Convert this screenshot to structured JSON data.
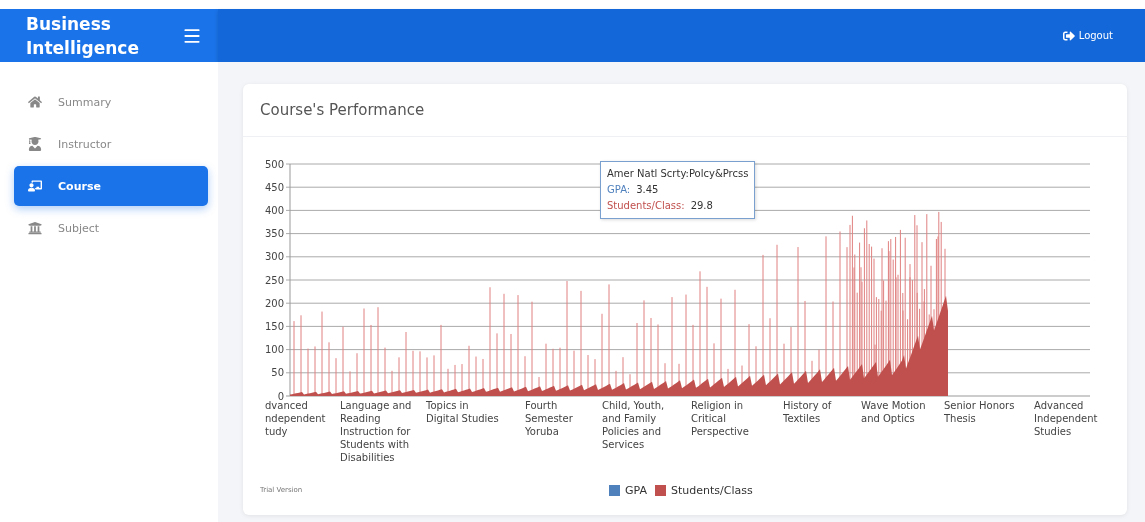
{
  "brand": {
    "title": "Business Intelligence"
  },
  "header": {
    "logout": "Logout"
  },
  "sidebar": {
    "items": [
      {
        "label": "Summary",
        "selected": false
      },
      {
        "label": "Instructor",
        "selected": false
      },
      {
        "label": "Course",
        "selected": true
      },
      {
        "label": "Subject",
        "selected": false
      }
    ]
  },
  "card": {
    "title": "Course's Performance",
    "chart": {
      "y_tick_labels": [
        "500",
        "450",
        "400",
        "350",
        "300",
        "250",
        "200",
        "150",
        "100",
        "50",
        "0"
      ],
      "x_labels": [
        "dvanced\nndependent\ntudy",
        "Language and\nReading\nInstruction for\nStudents with\nDisabilities",
        "Topics in\nDigital Studies",
        "Fourth\nSemester\nYoruba",
        "Child, Youth,\nand Family\nPolicies and\nServices",
        "Religion in\nCritical\nPerspective",
        "History of\nTextiles",
        "Wave Motion\nand Optics",
        "Senior Honors\nThesis",
        "Advanced\nIndependent\nStudies"
      ],
      "tooltip": {
        "title": "Amer Natl Scrty:Polcy&Prcss",
        "rows": [
          {
            "label": "GPA:",
            "value": "3.45",
            "color": "#4f81bd"
          },
          {
            "label": "Students/Class:",
            "value": "29.8",
            "color": "#c0504d"
          }
        ]
      },
      "legend": [
        {
          "label": "GPA",
          "color": "#4f81bd"
        },
        {
          "label": "Students/Class",
          "color": "#c0504d"
        }
      ]
    },
    "footnote": "Trial Version"
  }
}
